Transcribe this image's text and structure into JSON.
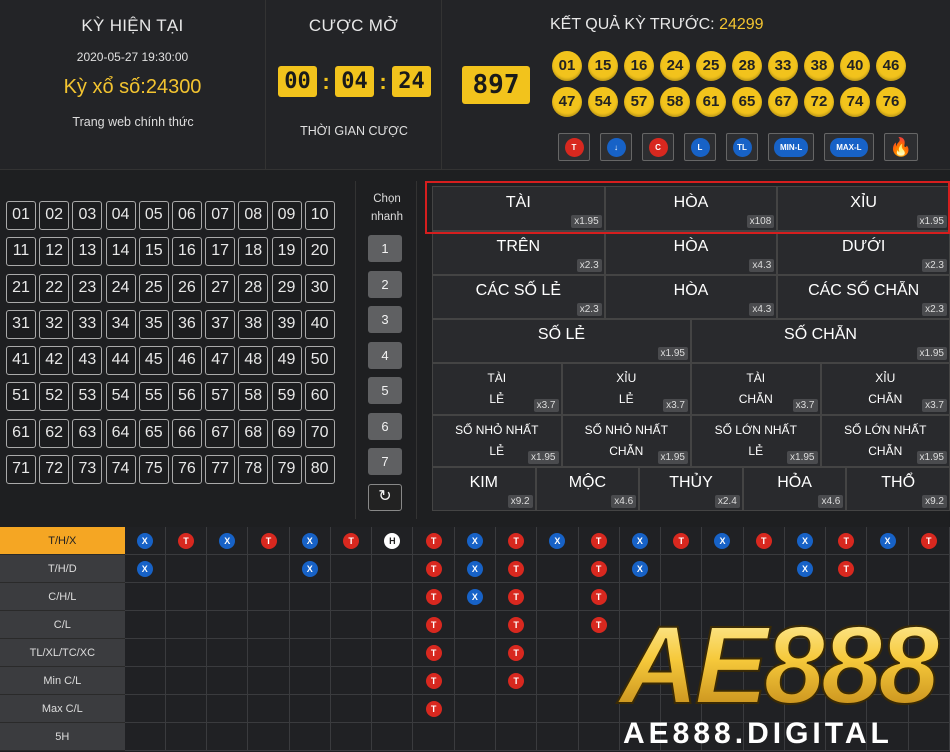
{
  "header": {
    "current": {
      "title": "KỲ HIỆN TẠI",
      "date": "2020-05-27 19:30:00",
      "round": "Kỳ xổ số:24300",
      "site": "Trang web chính thức"
    },
    "bet": {
      "title": "CƯỢC MỞ",
      "timer": [
        "00",
        "04",
        "24"
      ],
      "label": "THỜI GIAN CƯỢC"
    },
    "result": {
      "title": "KẾT QUẢ KỲ TRƯỚC:",
      "round": "24299",
      "code": "897",
      "balls": [
        "01",
        "15",
        "16",
        "24",
        "25",
        "28",
        "33",
        "38",
        "40",
        "46",
        "47",
        "54",
        "57",
        "58",
        "61",
        "65",
        "67",
        "72",
        "74",
        "76"
      ],
      "stat_buttons": [
        {
          "text": "T",
          "color": "red",
          "icon": "t-circle-icon"
        },
        {
          "text": "↓",
          "color": "blue",
          "icon": "down-arrow-icon"
        },
        {
          "text": "C",
          "color": "red",
          "icon": "c-circle-icon"
        },
        {
          "text": "L",
          "color": "blue",
          "icon": "l-circle-icon"
        },
        {
          "text": "TL",
          "color": "blue",
          "icon": "tl-circle-icon"
        },
        {
          "text": "MIN-L",
          "color": "blue",
          "icon": "min-l-icon"
        },
        {
          "text": "MAX-L",
          "color": "blue",
          "icon": "max-l-icon"
        },
        {
          "text": "🔥",
          "color": "fire",
          "icon": "fire-icon"
        }
      ]
    }
  },
  "numbers": [
    "01",
    "02",
    "03",
    "04",
    "05",
    "06",
    "07",
    "08",
    "09",
    "10",
    "11",
    "12",
    "13",
    "14",
    "15",
    "16",
    "17",
    "18",
    "19",
    "20",
    "21",
    "22",
    "23",
    "24",
    "25",
    "26",
    "27",
    "28",
    "29",
    "30",
    "31",
    "32",
    "33",
    "34",
    "35",
    "36",
    "37",
    "38",
    "39",
    "40",
    "41",
    "42",
    "43",
    "44",
    "45",
    "46",
    "47",
    "48",
    "49",
    "50",
    "51",
    "52",
    "53",
    "54",
    "55",
    "56",
    "57",
    "58",
    "59",
    "60",
    "61",
    "62",
    "63",
    "64",
    "65",
    "66",
    "67",
    "68",
    "69",
    "70",
    "71",
    "72",
    "73",
    "74",
    "75",
    "76",
    "77",
    "78",
    "79",
    "80"
  ],
  "quick": {
    "label": "Chọn nhanh",
    "buttons": [
      "1",
      "2",
      "3",
      "4",
      "5",
      "6",
      "7"
    ],
    "refresh": "↻"
  },
  "bets": {
    "row1": [
      {
        "label": "TÀI",
        "odds": "x1.95"
      },
      {
        "label": "HÒA",
        "odds": "x108"
      },
      {
        "label": "XỈU",
        "odds": "x1.95"
      }
    ],
    "row2": [
      {
        "label": "TRÊN",
        "odds": "x2.3"
      },
      {
        "label": "HÒA",
        "odds": "x4.3"
      },
      {
        "label": "DƯỚI",
        "odds": "x2.3"
      }
    ],
    "row3": [
      {
        "label": "CÁC SỐ LẺ",
        "odds": "x2.3"
      },
      {
        "label": "HÒA",
        "odds": "x4.3"
      },
      {
        "label": "CÁC SỐ CHẴN",
        "odds": "x2.3"
      }
    ],
    "row4": [
      {
        "label": "SỐ LẺ",
        "odds": "x1.95"
      },
      {
        "label": "SỐ CHẴN",
        "odds": "x1.95"
      }
    ],
    "row5": [
      {
        "l1": "TÀI",
        "l2": "LẺ",
        "odds": "x3.7"
      },
      {
        "l1": "XỈU",
        "l2": "LẺ",
        "odds": "x3.7"
      },
      {
        "l1": "TÀI",
        "l2": "CHẴN",
        "odds": "x3.7"
      },
      {
        "l1": "XỈU",
        "l2": "CHẴN",
        "odds": "x3.7"
      }
    ],
    "row6": [
      {
        "l1": "SỐ NHỎ NHẤT",
        "l2": "LẺ",
        "odds": "x1.95"
      },
      {
        "l1": "SỐ NHỎ NHẤT",
        "l2": "CHẴN",
        "odds": "x1.95"
      },
      {
        "l1": "SỐ LỚN NHẤT",
        "l2": "LẺ",
        "odds": "x1.95"
      },
      {
        "l1": "SỐ LỚN NHẤT",
        "l2": "CHẴN",
        "odds": "x1.95"
      }
    ],
    "row7": [
      {
        "label": "KIM",
        "odds": "x9.2"
      },
      {
        "label": "MỘC",
        "odds": "x4.6"
      },
      {
        "label": "THỦY",
        "odds": "x2.4"
      },
      {
        "label": "HỎA",
        "odds": "x4.6"
      },
      {
        "label": "THỔ",
        "odds": "x9.2"
      }
    ]
  },
  "history": {
    "rows": [
      {
        "label": "T/H/X",
        "active": true,
        "cells": [
          "X",
          "T",
          "X",
          "T",
          "X",
          "T",
          "H",
          "T",
          "X",
          "T",
          "X",
          "T",
          "X",
          "T",
          "X",
          "T",
          "X",
          "T",
          "X",
          "T"
        ]
      },
      {
        "label": "T/H/D",
        "active": false,
        "cells": [
          "X",
          "",
          "",
          "",
          "X",
          "",
          "",
          "T",
          "X",
          "T",
          "",
          "T",
          "X",
          "",
          "",
          "",
          "X",
          "T",
          "",
          ""
        ]
      },
      {
        "label": "C/H/L",
        "active": false,
        "cells": [
          "",
          "",
          "",
          "",
          "",
          "",
          "",
          "T",
          "X",
          "T",
          "",
          "T",
          "",
          "",
          "",
          "",
          "",
          "",
          "",
          ""
        ]
      },
      {
        "label": "C/L",
        "active": false,
        "cells": [
          "",
          "",
          "",
          "",
          "",
          "",
          "",
          "T",
          "",
          "T",
          "",
          "T",
          "",
          "",
          "",
          "",
          "",
          "",
          "",
          ""
        ]
      },
      {
        "label": "TL/XL/TC/XC",
        "active": false,
        "cells": [
          "",
          "",
          "",
          "",
          "",
          "",
          "",
          "T",
          "",
          "T",
          "",
          "",
          "",
          "",
          "",
          "",
          "",
          "",
          "",
          ""
        ]
      },
      {
        "label": "Min C/L",
        "active": false,
        "cells": [
          "",
          "",
          "",
          "",
          "",
          "",
          "",
          "T",
          "",
          "T",
          "",
          "",
          "",
          "",
          "",
          "",
          "",
          "",
          "",
          ""
        ]
      },
      {
        "label": "Max C/L",
        "active": false,
        "cells": [
          "",
          "",
          "",
          "",
          "",
          "",
          "",
          "T",
          "",
          "",
          "",
          "",
          "",
          "",
          "",
          "",
          "",
          "",
          "",
          ""
        ]
      },
      {
        "label": "5H",
        "active": false,
        "cells": [
          "",
          "",
          "",
          "",
          "",
          "",
          "",
          "",
          "",
          "",
          "",
          "",
          "",
          "",
          "",
          "",
          "",
          "",
          "",
          ""
        ]
      }
    ]
  },
  "watermark": {
    "brand": "AE888",
    "domain": "AE888.DIGITAL"
  },
  "colors": {
    "accent_yellow": "#f2c31c",
    "red": "#d8281f",
    "blue": "#1762c7",
    "highlight_border": "#d61e1e",
    "active_tab": "#f5a623"
  }
}
